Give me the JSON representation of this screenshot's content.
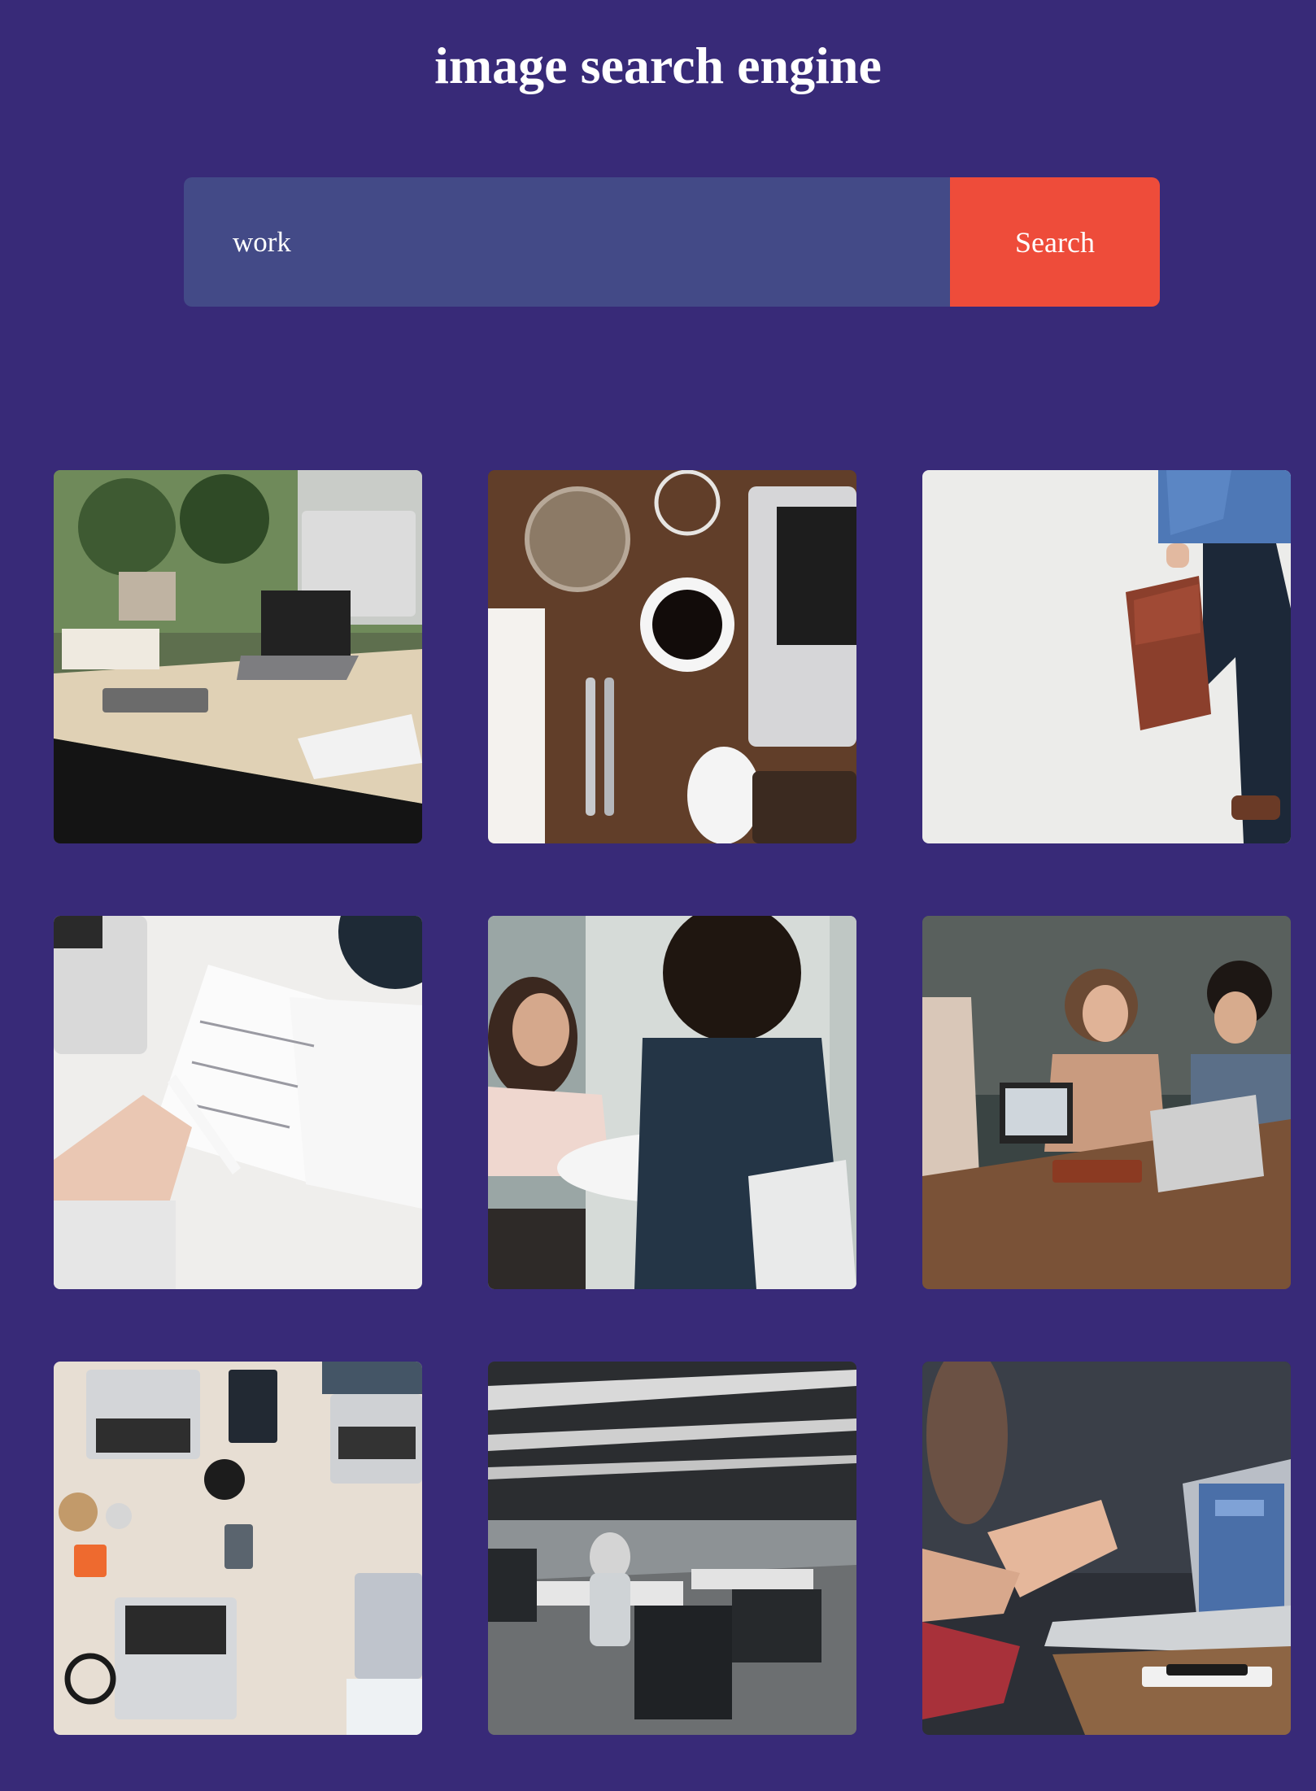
{
  "header": {
    "title": "image search engine"
  },
  "search": {
    "value": "work",
    "button_label": "Search"
  },
  "results": [
    {
      "name": "desk-with-imac-and-plants-photo"
    },
    {
      "name": "coffee-laptop-flatlay-photo"
    },
    {
      "name": "man-with-briefcase-photo"
    },
    {
      "name": "hand-writing-in-planner-photo"
    },
    {
      "name": "two-women-meeting-photo"
    },
    {
      "name": "team-laughing-with-laptops-photo"
    },
    {
      "name": "laptops-on-table-overhead-photo"
    },
    {
      "name": "open-plan-office-photo"
    },
    {
      "name": "hands-gesturing-at-laptop-photo"
    }
  ],
  "colors": {
    "background": "#382a78",
    "input_background": "#434a87",
    "button_background": "#ee4c3a",
    "text": "#ffffff"
  }
}
